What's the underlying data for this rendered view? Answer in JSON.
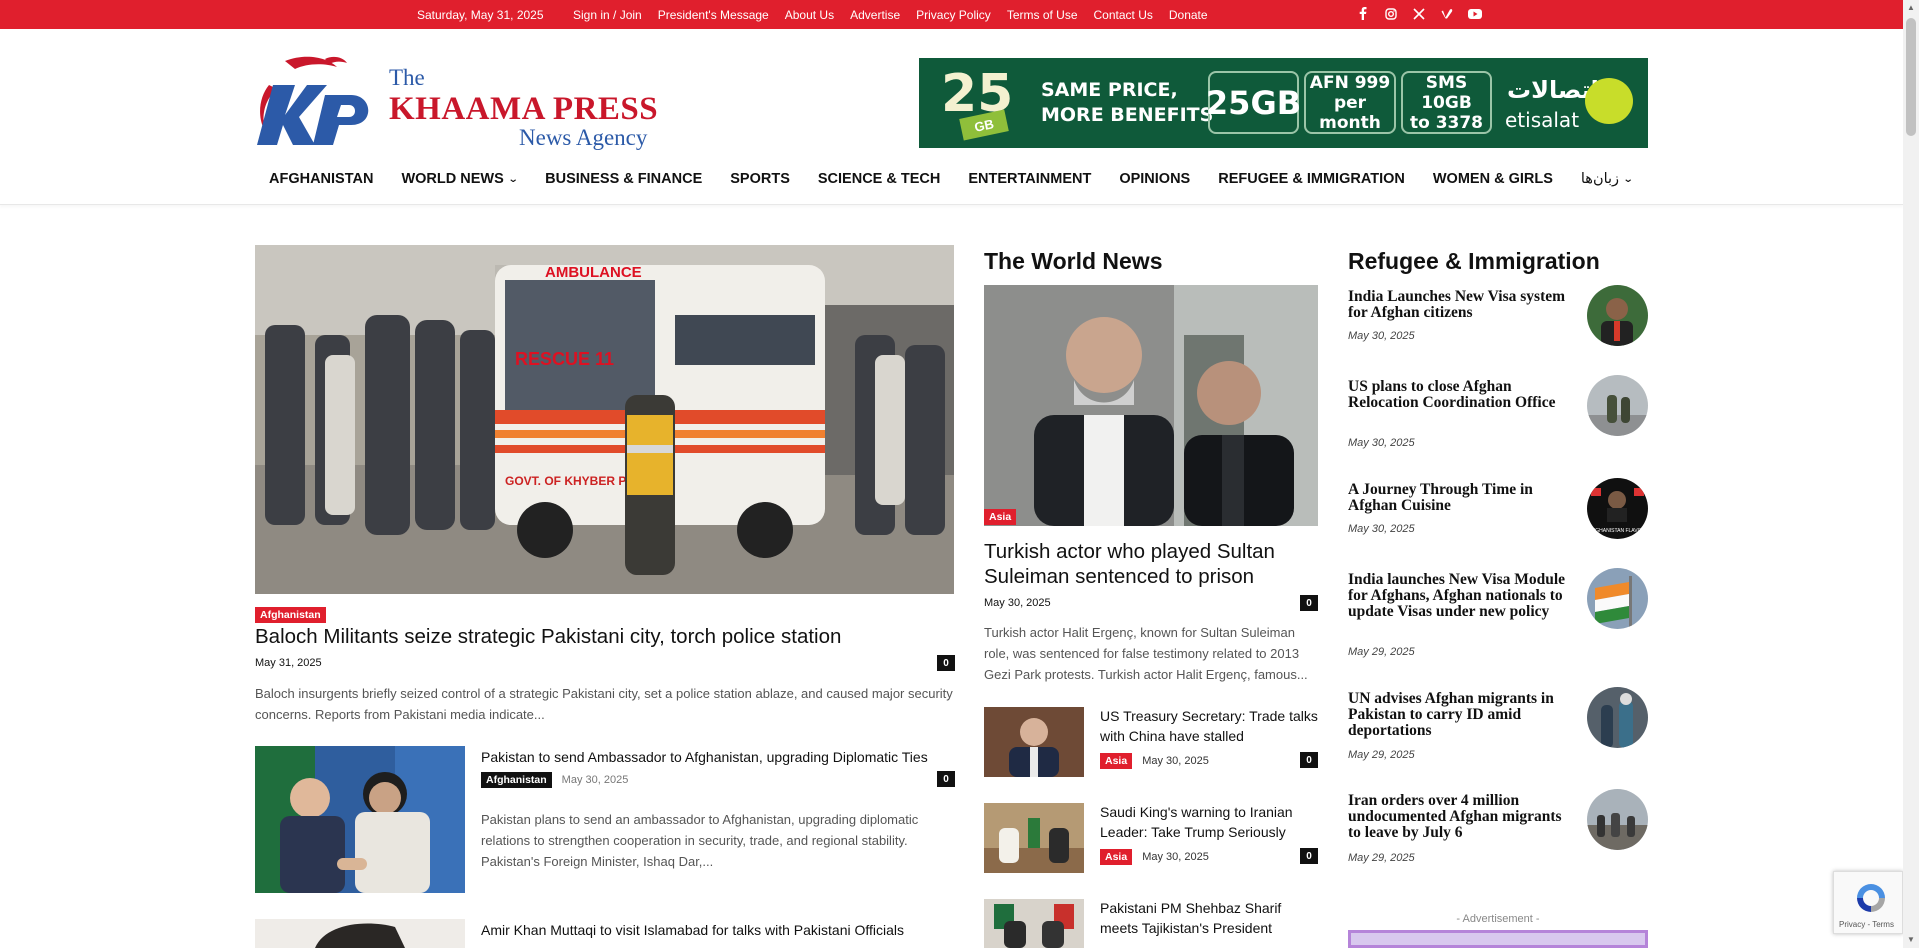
{
  "topbar": {
    "date": "Saturday, May 31, 2025",
    "links": [
      "Sign in / Join",
      "President's Message",
      "About Us",
      "Advertise",
      "Privacy Policy",
      "Terms of Use",
      "Contact Us",
      "Donate"
    ],
    "social_icons": [
      "facebook-icon",
      "instagram-icon",
      "x-icon",
      "vimeo-icon",
      "youtube-icon"
    ],
    "accent": "#e01f2d"
  },
  "logo": {
    "the": "The",
    "brand": "KHAAMA PRESS",
    "agency": "News Agency",
    "mark_text": "Kp"
  },
  "banner": {
    "number": "25",
    "gb": "GB",
    "slogan_line1": "SAME PRICE,",
    "slogan_line2": "MORE BENEFITS",
    "box1": "25GB",
    "box2_line1": "AFN 999",
    "box2_line2": "per month",
    "box3_line1": "SMS 10GB",
    "box3_line2": "to 3378",
    "arabic": "اتصالات",
    "brand": "etisalat"
  },
  "nav": [
    {
      "label": "AFGHANISTAN"
    },
    {
      "label": "WORLD NEWS",
      "has_dropdown": true
    },
    {
      "label": "BUSINESS & FINANCE"
    },
    {
      "label": "SPORTS"
    },
    {
      "label": "SCIENCE & TECH"
    },
    {
      "label": "ENTERTAINMENT"
    },
    {
      "label": "OPINIONS"
    },
    {
      "label": "REFUGEE & IMMIGRATION"
    },
    {
      "label": "WOMEN & GIRLS"
    },
    {
      "label": "زبان‌ها",
      "has_dropdown": true
    }
  ],
  "lead": {
    "ambulance_text": "AMBULANCE",
    "rescue_text": "RESCUE 11",
    "govt_text": "GOVT. OF KHYBER PAKHTU",
    "tag": "Afghanistan",
    "title": "Baloch Militants seize strategic Pakistani city, torch police station",
    "date": "May 31, 2025",
    "comments": "0",
    "excerpt": "Baloch insurgents briefly seized control of a strategic Pakistani city, set a police station ablaze, and caused major security concerns. Reports from Pakistani media indicate..."
  },
  "sub_articles": [
    {
      "title": "Pakistan to send Ambassador to Afghanistan, upgrading Diplomatic Ties",
      "tag": "Afghanistan",
      "date": "May 30, 2025",
      "comments": "0",
      "excerpt": "Pakistan plans to send an ambassador to Afghanistan, upgrading diplomatic relations to strengthen cooperation in security, trade, and regional stability. Pakistan's Foreign Minister, Ishaq Dar,..."
    },
    {
      "title": "Amir Khan Muttaqi to visit Islamabad for talks with Pakistani Officials"
    }
  ],
  "world_news": {
    "section_title": "The World News",
    "main": {
      "tag": "Asia",
      "title": "Turkish actor who played Sultan Suleiman sentenced to prison",
      "date": "May 30, 2025",
      "comments": "0",
      "excerpt": "Turkish actor Halit Ergenç, known for Sultan Suleiman role, was sentenced for false testimony related to 2013 Gezi Park protests. Turkish actor Halit Ergenç, famous..."
    },
    "items": [
      {
        "title": "US Treasury Secretary: Trade talks with China have stalled",
        "tag": "Asia",
        "date": "May 30, 2025",
        "comments": "0"
      },
      {
        "title": "Saudi King's warning to Iranian Leader: Take Trump Seriously",
        "tag": "Asia",
        "date": "May 30, 2025",
        "comments": "0"
      },
      {
        "title": "Pakistani PM Shehbaz Sharif meets Tajikistan's President"
      }
    ]
  },
  "refugee": {
    "section_title": "Refugee & Immigration",
    "items": [
      {
        "title": "India Launches New Visa system for Afghan citizens",
        "date": "May 30, 2025"
      },
      {
        "title": "US plans to close Afghan Relocation Coordination Office",
        "date": "May 30, 2025"
      },
      {
        "title": "A Journey Through Time in Afghan Cuisine",
        "date": "May 30, 2025",
        "thumb_text": "AFGHANISTAN FLAVOR"
      },
      {
        "title": "India launches New Visa Module for Afghans, Afghan nationals to update Visas under new policy",
        "date": "May 29, 2025"
      },
      {
        "title": "UN advises Afghan migrants in Pakistan to carry ID amid deportations",
        "date": "May 29, 2025"
      },
      {
        "title": "Iran orders over 4 million undocumented Afghan migrants to leave by July 6",
        "date": "May 29, 2025"
      }
    ],
    "ad_label": "- Advertisement -"
  },
  "recaptcha": {
    "text": "Privacy - Terms"
  }
}
